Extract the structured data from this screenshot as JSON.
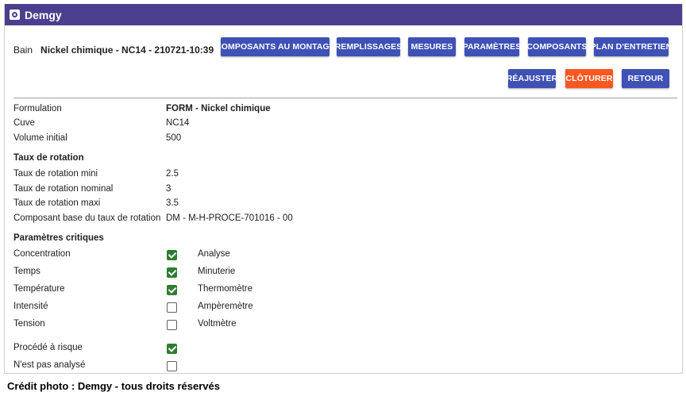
{
  "app": {
    "title": "Demgy"
  },
  "bath": {
    "label": "Bain",
    "value": "Nickel chimique - NC14 - 210721-10:39"
  },
  "toolbar": {
    "composants_montage": "Composants au montage",
    "remplissages": "Remplissages",
    "mesures": "Mesures",
    "parametres": "Paramètres",
    "composants": "Composants",
    "plan_entretien": "Plan d'entretien",
    "reajuster": "Réajuster",
    "cloturer": "Clôturer",
    "retour": "Retour"
  },
  "colors": {
    "header": "#4a3f8e",
    "primary_button": "#3f51b5",
    "cloturer_button": "#ff5722",
    "checkbox_checked": "#2e7d32"
  },
  "info": {
    "formulation_label": "Formulation",
    "formulation_value": "FORM - Nickel chimique",
    "cuve_label": "Cuve",
    "cuve_value": "NC14",
    "volume_label": "Volume initial",
    "volume_value": "500"
  },
  "rotation": {
    "title": "Taux de rotation",
    "mini_label": "Taux de rotation mini",
    "mini_value": "2.5",
    "nominal_label": "Taux de rotation nominal",
    "nominal_value": "3",
    "maxi_label": "Taux de rotation maxi",
    "maxi_value": "3.5",
    "base_label": "Composant base du taux de rotation",
    "base_value": "DM - M-H-PROCE-701016 - 00"
  },
  "critical": {
    "title": "Paramètres critiques",
    "rows": [
      {
        "label": "Concentration",
        "checked": true,
        "instrument": "Analyse"
      },
      {
        "label": "Temps",
        "checked": true,
        "instrument": "Minuterie"
      },
      {
        "label": "Température",
        "checked": true,
        "instrument": "Thermomètre"
      },
      {
        "label": "Intensité",
        "checked": false,
        "instrument": "Ampèremètre"
      },
      {
        "label": "Tension",
        "checked": false,
        "instrument": "Voltmètre"
      }
    ]
  },
  "flags": [
    {
      "label": "Procédé à risque",
      "checked": true
    },
    {
      "label": "N'est pas analysé",
      "checked": false
    }
  ],
  "credit": "Crédit photo : Demgy - tous droits réservés"
}
